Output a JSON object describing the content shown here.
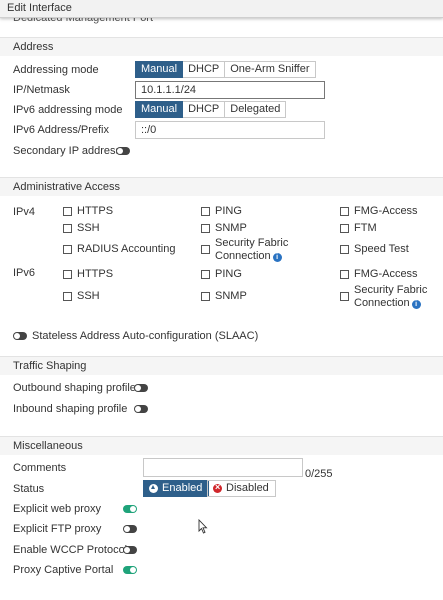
{
  "window": {
    "title": "Edit Interface"
  },
  "clipped": {
    "label": "Dedicated Management Port"
  },
  "address": {
    "header": "Address",
    "addressing_mode_label": "Addressing mode",
    "addressing_modes": [
      "Manual",
      "DHCP",
      "One-Arm Sniffer"
    ],
    "ip_label": "IP/Netmask",
    "ip_value": "10.1.1.1/24",
    "ipv6_mode_label": "IPv6 addressing mode",
    "ipv6_modes": [
      "Manual",
      "DHCP",
      "Delegated"
    ],
    "ipv6_prefix_label": "IPv6 Address/Prefix",
    "ipv6_prefix_value": "::/0",
    "secondary_label": "Secondary IP address"
  },
  "admin": {
    "header": "Administrative Access",
    "ipv4_label": "IPv4",
    "ipv6_label": "IPv6",
    "ipv4": [
      "HTTPS",
      "PING",
      "FMG-Access",
      "SSH",
      "SNMP",
      "FTM",
      "RADIUS Accounting",
      "Security Fabric",
      "Connection",
      "Speed Test"
    ],
    "ipv6": [
      "HTTPS",
      "PING",
      "FMG-Access",
      "SSH",
      "SNMP",
      "Security Fabric",
      "Connection"
    ],
    "slaac_label": "Stateless Address Auto-configuration (SLAAC)"
  },
  "traffic": {
    "header": "Traffic Shaping",
    "outbound_label": "Outbound shaping profile",
    "inbound_label": "Inbound shaping profile"
  },
  "misc": {
    "header": "Miscellaneous",
    "comments_label": "Comments",
    "comments_count": "0/255",
    "status_label": "Status",
    "status_enabled": "Enabled",
    "status_disabled": "Disabled",
    "web_proxy_label": "Explicit web proxy",
    "ftp_proxy_label": "Explicit FTP proxy",
    "wccp_label": "Enable WCCP Protocol",
    "captive_label": "Proxy Captive Portal"
  },
  "colors": {
    "accent": "#2e5f8a",
    "toggle_on": "#1fa37a",
    "info": "#2a73c2"
  }
}
